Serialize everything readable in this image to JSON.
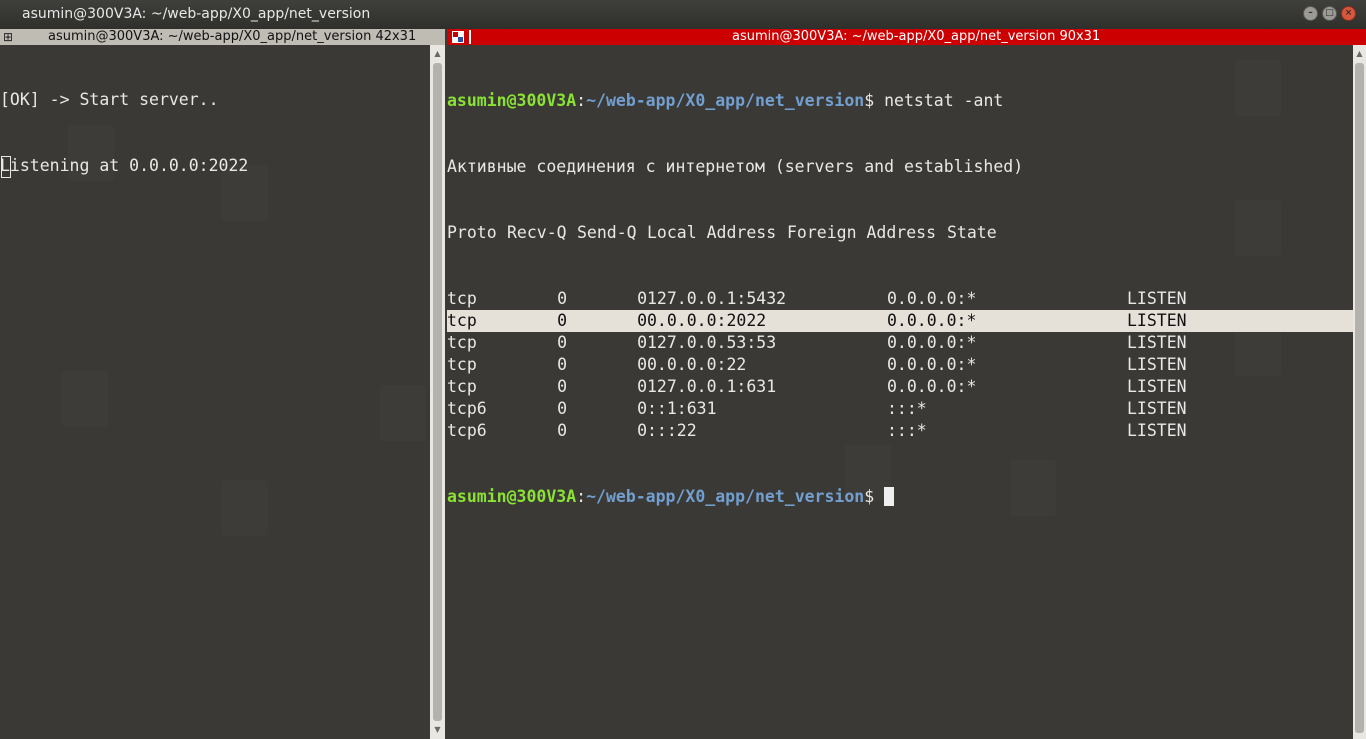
{
  "window": {
    "title": "asumin@300V3A: ~/web-app/X0_app/net_version",
    "buttons": {
      "minimize": "–",
      "maximize": "□",
      "close": "×"
    }
  },
  "left_pane": {
    "tab_title": "asumin@300V3A: ~/web-app/X0_app/net_version 42x31",
    "lines": [
      "[OK] -> Start server..",
      "Listening at 0.0.0.0:2022"
    ]
  },
  "right_pane": {
    "tab_title": "asumin@300V3A: ~/web-app/X0_app/net_version 90x31",
    "prompt_user": "asumin@300V3A",
    "prompt_sep": ":",
    "prompt_path": "~/web-app/X0_app/net_version",
    "prompt_end": "$",
    "command": " netstat -ant",
    "header_line": "Активные соединения с интернетом (servers and established)",
    "columns": {
      "proto": "Proto",
      "recvq": "Recv-Q",
      "sendq": "Send-Q",
      "local": "Local Address",
      "foreign": "Foreign Address",
      "state": "State"
    },
    "rows": [
      {
        "proto": "tcp",
        "recvq": "0",
        "sendq": "0",
        "local": "127.0.0.1:5432",
        "foreign": "0.0.0.0:*",
        "state": "LISTEN",
        "highlighted": false
      },
      {
        "proto": "tcp",
        "recvq": "0",
        "sendq": "0",
        "local": "0.0.0.0:2022",
        "foreign": "0.0.0.0:*",
        "state": "LISTEN",
        "highlighted": true
      },
      {
        "proto": "tcp",
        "recvq": "0",
        "sendq": "0",
        "local": "127.0.0.53:53",
        "foreign": "0.0.0.0:*",
        "state": "LISTEN",
        "highlighted": false
      },
      {
        "proto": "tcp",
        "recvq": "0",
        "sendq": "0",
        "local": "0.0.0.0:22",
        "foreign": "0.0.0.0:*",
        "state": "LISTEN",
        "highlighted": false
      },
      {
        "proto": "tcp",
        "recvq": "0",
        "sendq": "0",
        "local": "127.0.0.1:631",
        "foreign": "0.0.0.0:*",
        "state": "LISTEN",
        "highlighted": false
      },
      {
        "proto": "tcp6",
        "recvq": "0",
        "sendq": "0",
        "local": "::1:631",
        "foreign": ":::*",
        "state": "LISTEN",
        "highlighted": false
      },
      {
        "proto": "tcp6",
        "recvq": "0",
        "sendq": "0",
        "local": ":::22",
        "foreign": ":::*",
        "state": "LISTEN",
        "highlighted": false
      }
    ]
  },
  "colors": {
    "tab_active": "#cc0000",
    "tab_inactive": "#bfbcb4",
    "prompt_user": "#8ae234",
    "prompt_path": "#729fcf",
    "highlight_row": "#e6e1d8"
  }
}
